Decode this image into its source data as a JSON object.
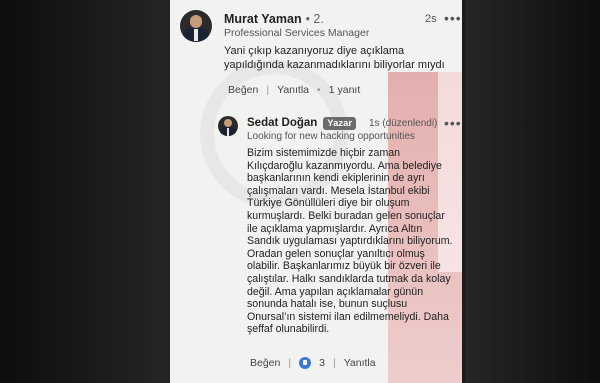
{
  "comment": {
    "author": "Murat Yaman",
    "degree": "• 2.",
    "headline": "Professional Services Manager",
    "time": "2s",
    "menu": "•••",
    "text": "Yani çıkıp kazanıyoruz diye açıklama yapıldığında kazanmadıklarını biliyorlar mıydı",
    "like_label": "Beğen",
    "reply_label": "Yanıtla",
    "replies_count": "1 yanıt"
  },
  "reply": {
    "author": "Sedat Doğan",
    "badge": "Yazar",
    "headline": "Looking for new hacking opportunities",
    "time": "1s (düzenlendi)",
    "menu": "•••",
    "text": "Bizim sistemimizde hiçbir zaman Kılıçdaroğlu kazanmıyordu. Ama belediye başkanlarının kendi ekiplerinin de ayrı çalışmaları vardı. Mesela İstanbul ekibi Türkiye Gönüllüleri diye bir oluşum kurmuşlardı. Belki buradan gelen sonuçlar ile açıklama yapmışlardır. Ayrıca Altın Sandık uygulaması yaptırdıklarını biliyorum. Oradan gelen sonuçlar yanıltıcı olmuş olabilir. Başkanlarımız büyük bir özveri ile çalıştılar. Halkı sandıklarda tutmak da kolay değil. Ama yapılan açıklamalar günün sonunda hatalı ise, bunun suçlusu Onursal’ın sistemi ilan edilmemeliydi. Daha şeffaf olunabilirdi.",
    "like_label": "Beğen",
    "reactions_count": "3",
    "reply_label": "Yanıtla"
  },
  "icons": {
    "like": "like-icon",
    "avatar": "avatar"
  },
  "colors": {
    "accent": "#3a78d6",
    "watermark": "#d77878",
    "badge": "#6b6b6b"
  }
}
